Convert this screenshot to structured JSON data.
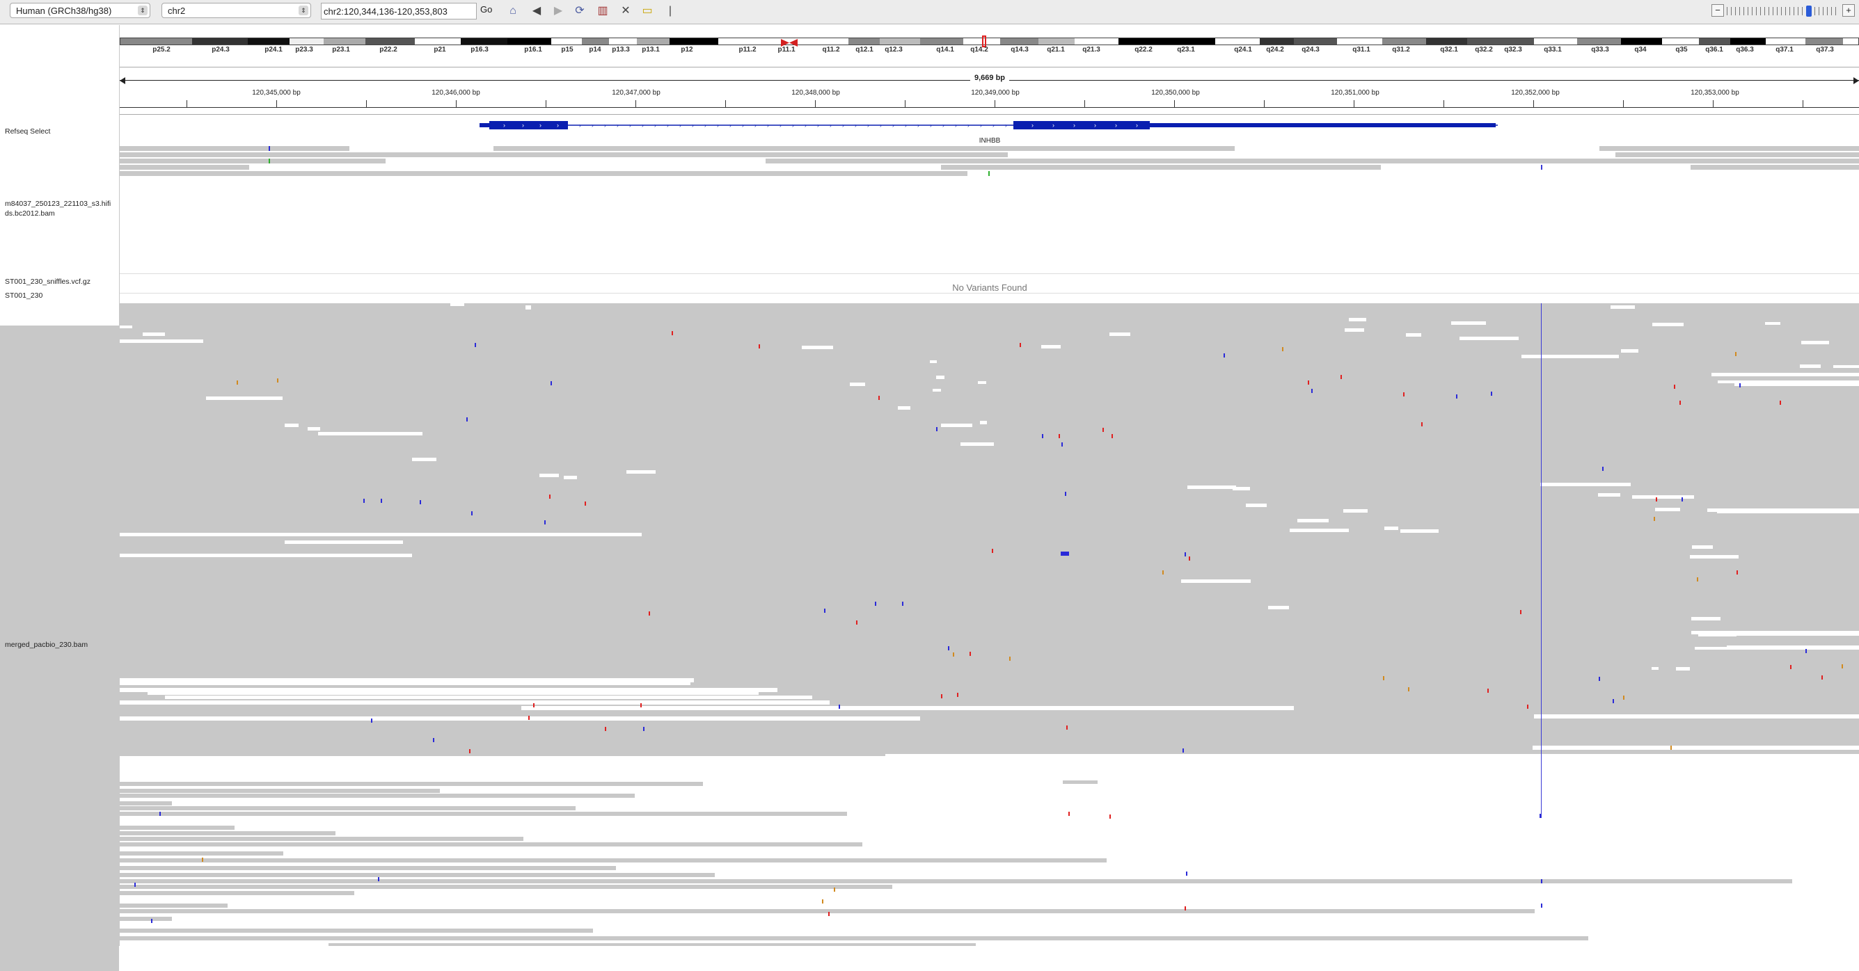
{
  "toolbar": {
    "genome": "Human (GRCh38/hg38)",
    "chromosome": "chr2",
    "locus": "chr2:120,344,136-120,353,803",
    "go_label": "Go",
    "icons": [
      "home-icon",
      "back-arrow-icon",
      "forward-arrow-icon",
      "refresh-icon",
      "region-navigator-icon",
      "resize-icon",
      "popup-text-icon",
      "ruler-divider"
    ]
  },
  "ideogram": {
    "bands": [
      "p25.2",
      "p24.3",
      "p24.1",
      "p23.3",
      "p23.1",
      "p22.2",
      "p21",
      "p16.3",
      "p16.1",
      "p15",
      "p14",
      "p13.3",
      "p13.1",
      "p12",
      "p11.2",
      "p11.1",
      "q11.2",
      "q12.1",
      "q12.3",
      "q14.1",
      "q14.2",
      "q14.3",
      "q21.1",
      "q21.3",
      "q22.2",
      "q23.1",
      "q24.1",
      "q24.2",
      "q24.3",
      "q31.1",
      "q31.2",
      "q32.1",
      "q32.2",
      "q32.3",
      "q33.1",
      "q33.3",
      "q34",
      "q35",
      "q36.1",
      "q36.3",
      "q37.1",
      "q37.3"
    ]
  },
  "ruler": {
    "span": "9,669 bp",
    "ticks": [
      "120,345,000 bp",
      "120,346,000 bp",
      "120,347,000 bp",
      "120,348,000 bp",
      "120,349,000 bp",
      "120,350,000 bp",
      "120,351,000 bp",
      "120,352,000 bp",
      "120,353,000 bp"
    ]
  },
  "tracks": {
    "refseq": "Refseq Select",
    "gene": "INHBB",
    "bam1": "m84037_250123_221103_s3.hifi ds.bc2012.bam",
    "vcf": "ST001_230_sniffles.vcf.gz",
    "sample": "ST001_230",
    "no_variants": "No Variants Found",
    "bam2": "merged_pacbio_230.bam"
  },
  "colors": {
    "read": "#c8c8c8",
    "gene": "#0a1fb0",
    "insertion": "#3a3ad6",
    "mismatch_a": "#2fb02f",
    "mismatch_t": "#e02020",
    "mismatch_c": "#2a2ad8",
    "mismatch_g": "#d18a1f"
  }
}
